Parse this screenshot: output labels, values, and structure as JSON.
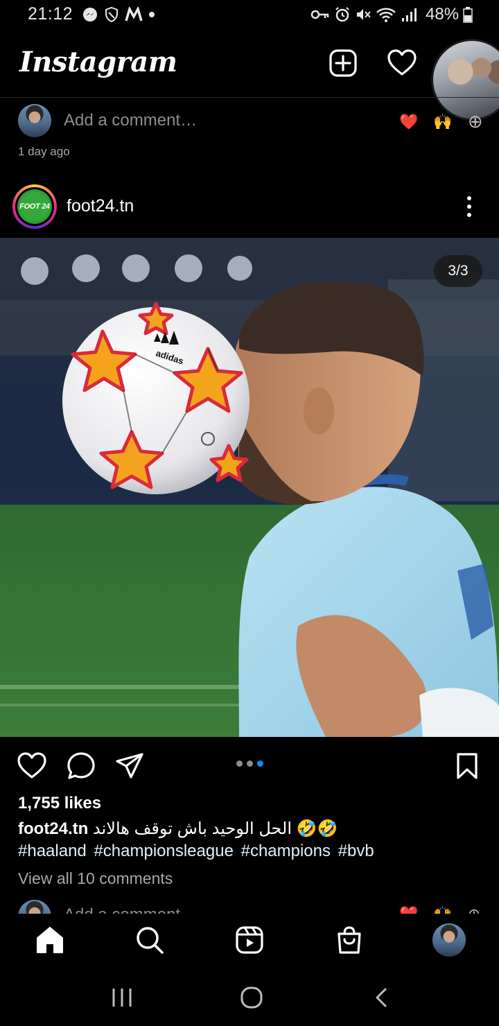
{
  "status_bar": {
    "time": "21:12",
    "battery_percent": "48%",
    "left_icons": [
      "messenger-icon",
      "shield-icon",
      "m-app-icon",
      "dot-icon"
    ],
    "right_icons": [
      "key-icon",
      "alarm-icon",
      "mute-icon",
      "wifi-icon",
      "signal-icon",
      "battery-icon"
    ]
  },
  "header": {
    "logo": "Instagram",
    "icons": [
      "new-post-icon",
      "heart-icon"
    ]
  },
  "previous_post": {
    "comment_placeholder": "Add a comment…",
    "quick_reactions": [
      "❤️",
      "🙌",
      "⊕"
    ],
    "timestamp": "1 day ago"
  },
  "post": {
    "username": "foot24.tn",
    "avatar_label": "FOOT 24",
    "photo_counter": "3/3",
    "carousel": {
      "total": 3,
      "active": 3
    },
    "likes": "1,755 likes",
    "caption_username": "foot24.tn",
    "caption_text": "🤣🤣 الحل الوحيد باش توقف هالاند",
    "hashtags": [
      "#haaland",
      "#championsleague",
      "#champions",
      "#bvb"
    ],
    "view_comments": "View all 10 comments",
    "comment_placeholder": "Add a comment…",
    "quick_reactions": [
      "❤️",
      "🙌",
      "⊕"
    ]
  },
  "bottom_nav": {
    "items": [
      "home",
      "search",
      "reels",
      "shop",
      "profile"
    ],
    "active": "home"
  },
  "colors": {
    "background": "#000000",
    "accent_blue": "#0095f6",
    "muted_text": "#8e8e8e",
    "hashtag": "#e0f1ff"
  }
}
